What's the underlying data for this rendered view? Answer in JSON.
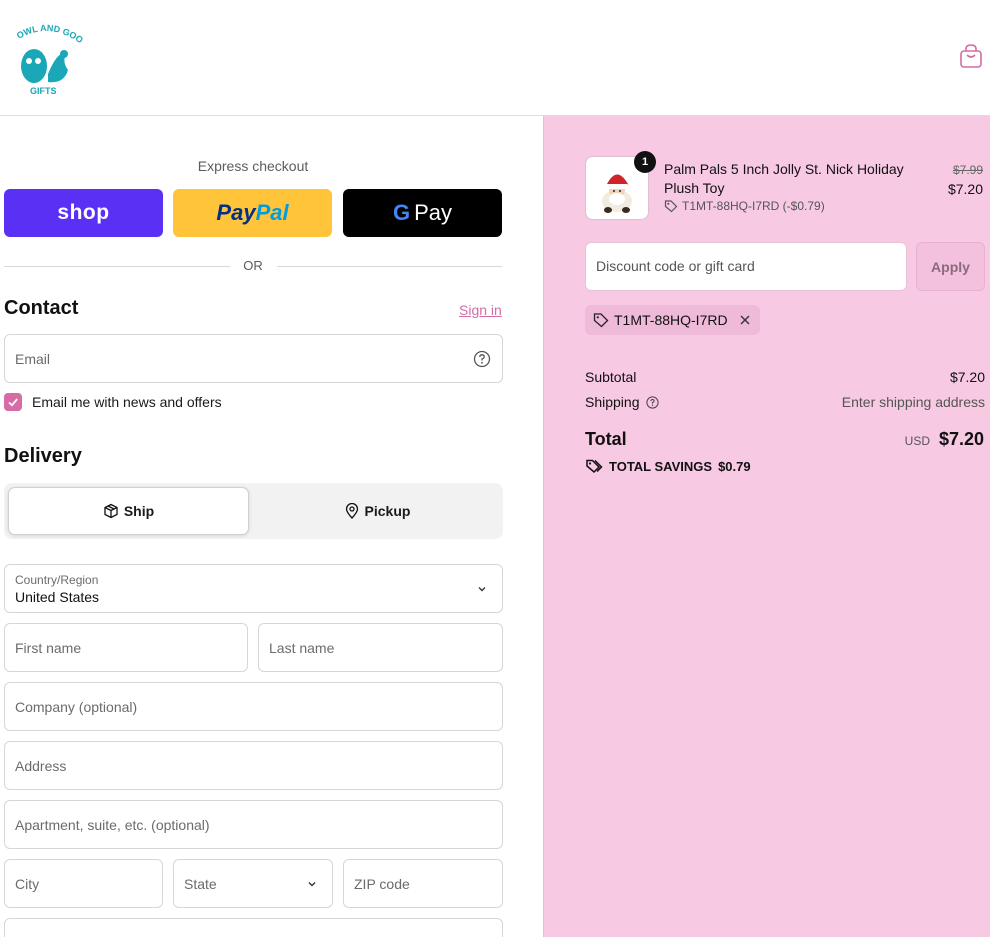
{
  "header": {
    "logo_top": "OWL AND GOOSE",
    "logo_bottom": "GIFTS"
  },
  "express": {
    "label": "Express checkout",
    "shop_label": "shop",
    "paypal_part1": "Pay",
    "paypal_part2": "Pal",
    "gpay_g": "G",
    "gpay_label": "Pay",
    "or": "OR"
  },
  "contact": {
    "title": "Contact",
    "sign_in": "Sign in",
    "email_placeholder": "Email",
    "newsletter_label": "Email me with news and offers",
    "newsletter_checked": true
  },
  "delivery": {
    "title": "Delivery",
    "tabs": [
      {
        "label": "Ship",
        "selected": true
      },
      {
        "label": "Pickup",
        "selected": false
      }
    ],
    "country_label": "Country/Region",
    "country_value": "United States",
    "first_name": "First name",
    "last_name": "Last name",
    "company": "Company (optional)",
    "address": "Address",
    "apartment": "Apartment, suite, etc. (optional)",
    "city": "City",
    "state": "State",
    "zip": "ZIP code"
  },
  "order": {
    "item": {
      "quantity": "1",
      "name": "Palm Pals 5 Inch Jolly St. Nick Holiday Plush Toy",
      "discount_code": "T1MT-88HQ-I7RD (-$0.79)",
      "original_price": "$7.99",
      "price": "$7.20"
    },
    "discount_placeholder": "Discount code or gift card",
    "apply_label": "Apply",
    "applied_code": "T1MT-88HQ-I7RD",
    "subtotal_label": "Subtotal",
    "subtotal_value": "$7.20",
    "shipping_label": "Shipping",
    "shipping_value": "Enter shipping address",
    "total_label": "Total",
    "currency": "USD",
    "total_value": "$7.20",
    "savings_label": "TOTAL SAVINGS",
    "savings_value": "$0.79"
  },
  "colors": {
    "accent": "#d66ba5",
    "summary_bg": "#f7c9e3",
    "shop_purple": "#5a31f4",
    "paypal_yellow": "#ffc43a"
  }
}
